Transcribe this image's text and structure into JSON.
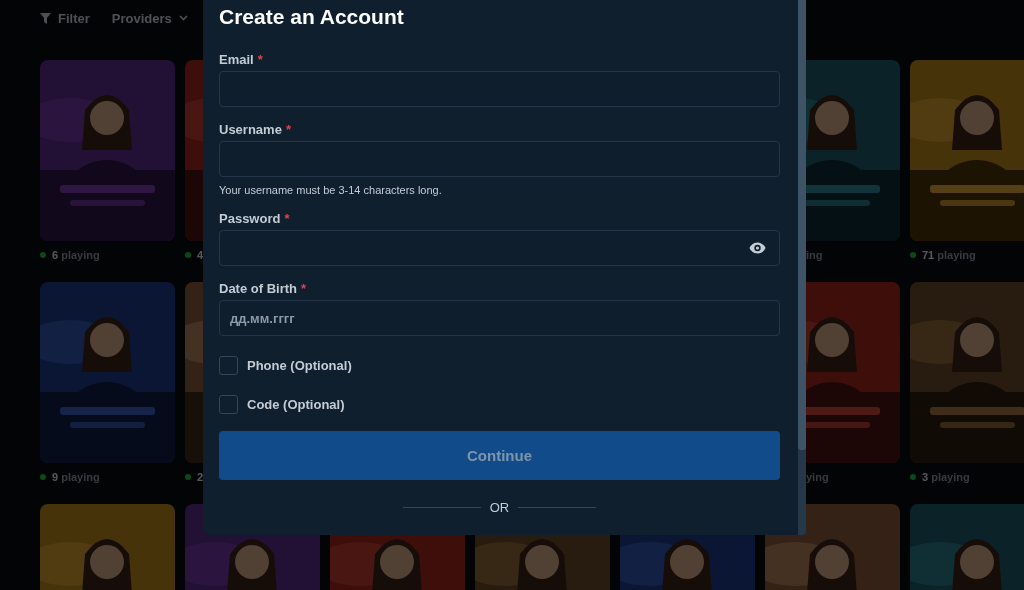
{
  "toolbar": {
    "filter": "Filter",
    "providers": "Providers"
  },
  "game_rows": [
    {
      "tiles": [
        {
          "kind": "picture",
          "playing": "**6** playing"
        },
        {
          "kind": "picture",
          "playing": "**4**"
        },
        {
          "kind": "picture",
          "playing": "ing"
        },
        {
          "kind": "picture",
          "playing": "**71** playing"
        }
      ]
    },
    {
      "tiles": [
        {
          "kind": "picture",
          "playing": "**9** playing"
        },
        {
          "kind": "picture",
          "playing": "**2**"
        },
        {
          "kind": "picture",
          "playing": "ying"
        },
        {
          "kind": "picture",
          "playing": "**3** playing"
        }
      ]
    },
    {
      "tiles": [
        {
          "kind": "picture"
        },
        {
          "kind": "picture"
        },
        {
          "kind": "picture"
        },
        {
          "kind": "picture"
        },
        {
          "kind": "picture"
        },
        {
          "kind": "picture"
        },
        {
          "kind": "picture"
        }
      ]
    }
  ],
  "modal": {
    "title": "Create an Account",
    "fields": [
      {
        "kind": "email",
        "label": "Email",
        "required_mark": "*"
      },
      {
        "kind": "text",
        "label": "Username",
        "required_mark": "*",
        "hint": "Your username must be 3-14 characters long."
      },
      {
        "kind": "password",
        "label": "Password",
        "required_mark": "*"
      },
      {
        "kind": "date",
        "label": "Date of Birth",
        "required_mark": "*",
        "placeholder": "дд.мм.гггг"
      }
    ],
    "options": [
      {
        "label": "Phone (Optional)",
        "checked": false
      },
      {
        "label": "Code (Optional)",
        "checked": false
      }
    ],
    "button": {
      "label": "Continue",
      "disabled": true
    },
    "divider": "OR"
  }
}
